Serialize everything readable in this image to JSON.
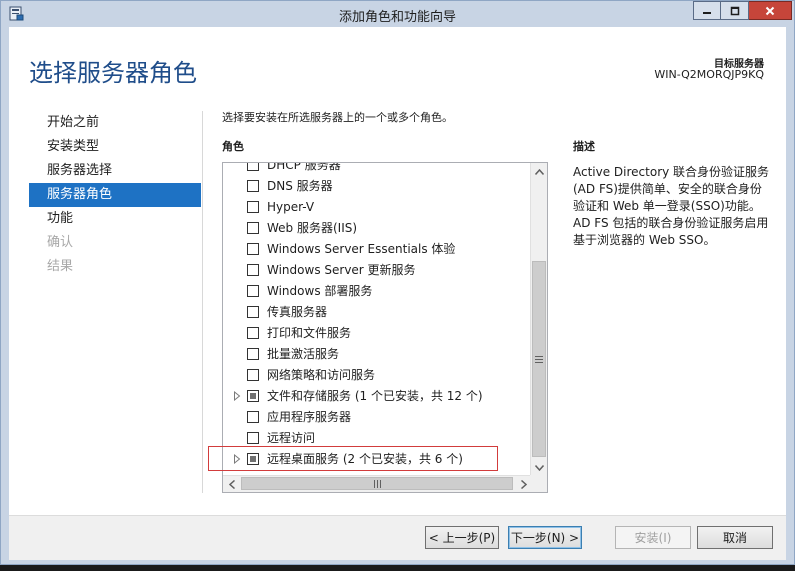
{
  "window": {
    "title": "添加角色和功能向导"
  },
  "header": {
    "page_title": "选择服务器角色",
    "target_label": "目标服务器",
    "target_value": "WIN-Q2MORQJP9KQ"
  },
  "nav": {
    "items": [
      {
        "label": "开始之前",
        "state": "normal"
      },
      {
        "label": "安装类型",
        "state": "normal"
      },
      {
        "label": "服务器选择",
        "state": "normal"
      },
      {
        "label": "服务器角色",
        "state": "active"
      },
      {
        "label": "功能",
        "state": "normal"
      },
      {
        "label": "确认",
        "state": "disabled"
      },
      {
        "label": "结果",
        "state": "disabled"
      }
    ]
  },
  "main": {
    "instruction": "选择要安装在所选服务器上的一个或多个角色。",
    "roles_header": "角色",
    "description_header": "描述",
    "description_text": "Active Directory 联合身份验证服务(AD FS)提供简单、安全的联合身份验证和 Web 单一登录(SSO)功能。AD FS 包括的联合身份验证服务启用基于浏览器的 Web SSO。",
    "roles": [
      {
        "label": "DHCP 服务器",
        "checked": "none",
        "expandable": false
      },
      {
        "label": "DNS 服务器",
        "checked": "none",
        "expandable": false
      },
      {
        "label": "Hyper-V",
        "checked": "none",
        "expandable": false
      },
      {
        "label": "Web 服务器(IIS)",
        "checked": "none",
        "expandable": false
      },
      {
        "label": "Windows Server Essentials 体验",
        "checked": "none",
        "expandable": false
      },
      {
        "label": "Windows Server 更新服务",
        "checked": "none",
        "expandable": false
      },
      {
        "label": "Windows 部署服务",
        "checked": "none",
        "expandable": false
      },
      {
        "label": "传真服务器",
        "checked": "none",
        "expandable": false
      },
      {
        "label": "打印和文件服务",
        "checked": "none",
        "expandable": false
      },
      {
        "label": "批量激活服务",
        "checked": "none",
        "expandable": false
      },
      {
        "label": "网络策略和访问服务",
        "checked": "none",
        "expandable": false
      },
      {
        "label": "文件和存储服务 (1 个已安装，共 12 个)",
        "checked": "partial",
        "expandable": true
      },
      {
        "label": "应用程序服务器",
        "checked": "none",
        "expandable": false
      },
      {
        "label": "远程访问",
        "checked": "none",
        "expandable": false
      },
      {
        "label": "远程桌面服务 (2 个已安装，共 6 个)",
        "checked": "partial",
        "expandable": true
      }
    ]
  },
  "footer": {
    "prev_label": "< 上一步(P)",
    "next_label": "下一步(N) >",
    "install_label": "安装(I)",
    "cancel_label": "取消"
  }
}
